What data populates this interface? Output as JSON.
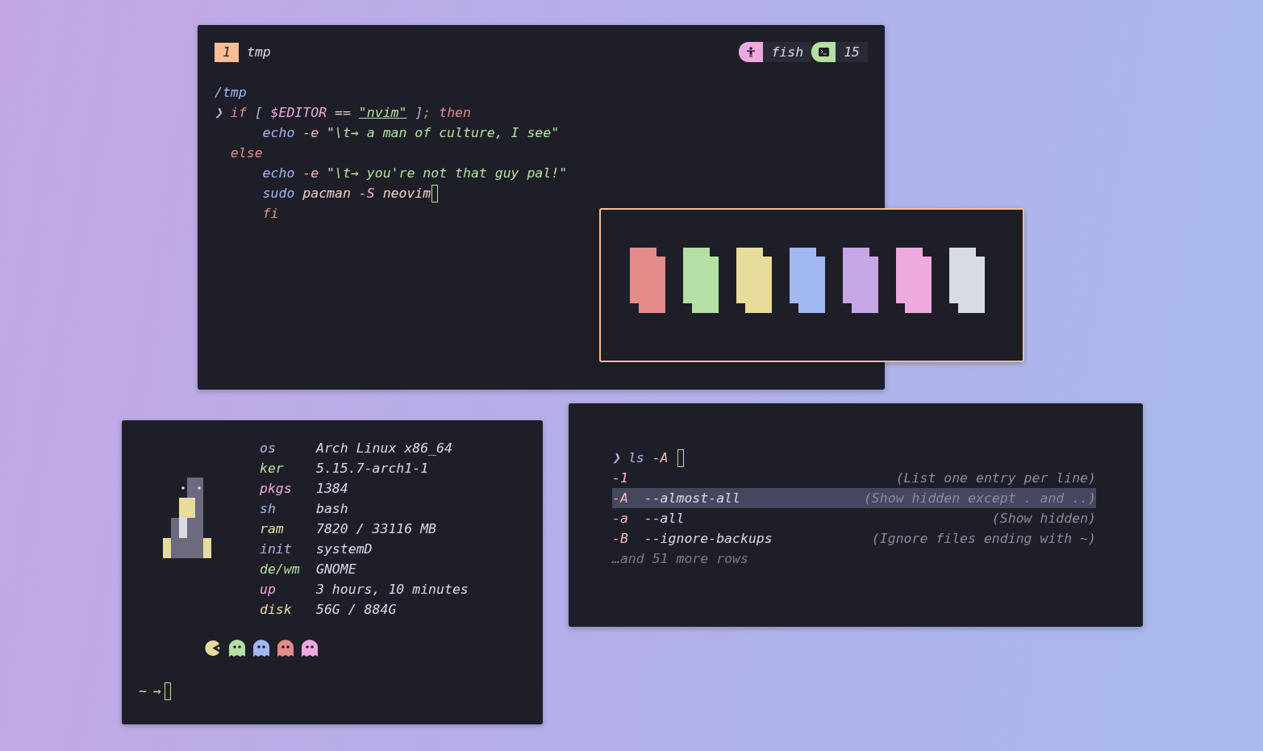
{
  "editor_window": {
    "tab": {
      "number": "1",
      "name": "tmp"
    },
    "status": [
      {
        "kind": "person",
        "color": "#eeaade",
        "label": "fish"
      },
      {
        "kind": "terminal",
        "color": "#b4e0a3",
        "label": "15"
      }
    ],
    "cwd": "/tmp",
    "lines": [
      [
        {
          "text": "❯",
          "color": "#c6a8e6"
        },
        {
          "text": " if",
          "color": "#e38c8a"
        },
        {
          "text": " [",
          "color": "#a2b8f0"
        },
        {
          "text": " $EDITOR",
          "color": "#eeaade"
        },
        {
          "text": " == ",
          "color": "#f2cdcd"
        },
        {
          "text": "\"nvim\"",
          "color": "#b4e0a3",
          "underline": true
        },
        {
          "text": " ]",
          "color": "#a2b8f0"
        },
        {
          "text": ";",
          "color": "#e38c8a"
        },
        {
          "text": " then",
          "color": "#e38c8a"
        }
      ],
      [
        {
          "text": "      echo",
          "color": "#a2b8f0"
        },
        {
          "text": " -e",
          "color": "#f2b8b8"
        },
        {
          "text": " \"\\t→ a man of culture, I see\"",
          "color": "#b4e0a3"
        }
      ],
      [
        {
          "text": "  else",
          "color": "#e38c8a"
        }
      ],
      [
        {
          "text": "      echo",
          "color": "#a2b8f0"
        },
        {
          "text": " -e",
          "color": "#f2b8b8"
        },
        {
          "text": " \"\\t→ you're not that guy pal!\"",
          "color": "#b4e0a3"
        }
      ],
      [
        {
          "text": "      sudo",
          "color": "#a2b8f0"
        },
        {
          "text": " pacman",
          "color": "#f2cdcd"
        },
        {
          "text": " -S",
          "color": "#f2b8b8"
        },
        {
          "text": " neovim",
          "color": "#f2cdcd"
        },
        {
          "kind": "cursor"
        }
      ],
      [
        {
          "text": "      fi",
          "color": "#e38c8a"
        }
      ]
    ]
  },
  "palette_window": {
    "swatches": [
      {
        "color": "#e38c8a"
      },
      {
        "color": "#b4e0a3"
      },
      {
        "color": "#e8dc9c"
      },
      {
        "color": "#a2b8f0"
      },
      {
        "color": "#c6a8e6"
      },
      {
        "color": "#eeaade"
      },
      {
        "color": "#d9dbe2"
      }
    ]
  },
  "fetch_window": {
    "info": [
      {
        "label": "os",
        "color": "#c6a8e6",
        "value": "Arch Linux x86_64"
      },
      {
        "label": "ker",
        "color": "#b4e0a3",
        "value": "5.15.7-arch1-1"
      },
      {
        "label": "pkgs",
        "color": "#eeaade",
        "value": "1384"
      },
      {
        "label": "sh",
        "color": "#a2b8f0",
        "value": "bash"
      },
      {
        "label": "ram",
        "color": "#e8dc9c",
        "value": "7820 / 33116 MB"
      },
      {
        "label": "init",
        "color": "#c6a8e6",
        "value": "systemD"
      },
      {
        "label": "de/wm",
        "color": "#b4e0a3",
        "value": "GNOME"
      },
      {
        "label": "up",
        "color": "#eeaade",
        "value": "3 hours, 10 minutes"
      },
      {
        "label": "disk",
        "color": "#e8dc9c",
        "value": "56G / 884G"
      }
    ],
    "sprites": [
      {
        "kind": "pacman",
        "color": "#e8dc9c"
      },
      {
        "kind": "ghost",
        "color": "#b4e0a3"
      },
      {
        "kind": "ghost",
        "color": "#a2b8f0"
      },
      {
        "kind": "ghost",
        "color": "#e38c8a"
      },
      {
        "kind": "ghost",
        "color": "#eeaade"
      }
    ],
    "prompt": {
      "dir": "~",
      "arrow": "→"
    }
  },
  "ls_window": {
    "prompt": {
      "symbol": "❯",
      "command": "ls",
      "arg": "-A"
    },
    "rows": [
      {
        "flag": "-1",
        "description": "(List one entry per line)",
        "selected": false
      },
      {
        "flag": "-A",
        "long": "--almost-all",
        "description": "(Show hidden except . and ..)",
        "selected": true
      },
      {
        "flag": "-a",
        "long": "--all",
        "description": "(Show hidden)",
        "selected": false
      },
      {
        "flag": "-B",
        "long": "--ignore-backups",
        "description": "(Ignore files ending with ~)",
        "selected": false
      }
    ],
    "more": "…and 51 more rows"
  }
}
